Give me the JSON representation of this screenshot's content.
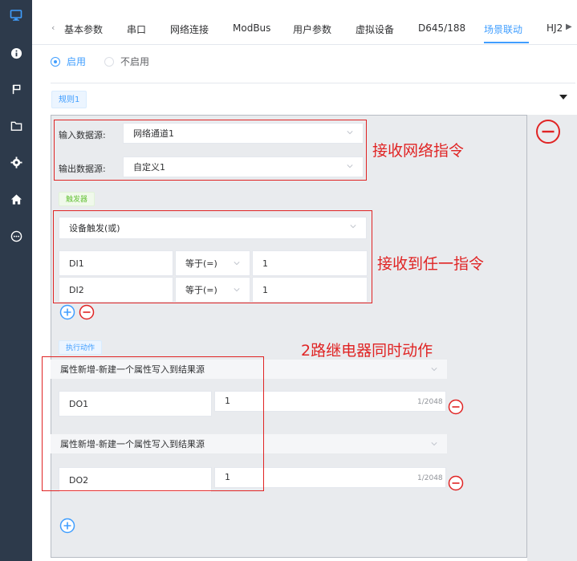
{
  "sidebar": {
    "icons": [
      "monitor-icon",
      "info-icon",
      "flag-icon",
      "folder-icon",
      "gear-icon",
      "home-icon",
      "chat-icon"
    ]
  },
  "tabs": {
    "items": [
      "基本参数",
      "串口",
      "网络连接",
      "ModBus",
      "用户参数",
      "虚拟设备",
      "D645/188",
      "场景联动",
      "HJ2"
    ],
    "active": "场景联动"
  },
  "enable": {
    "on_label": "启用",
    "off_label": "不启用"
  },
  "rule": {
    "tag": "规则1"
  },
  "source": {
    "input_label": "输入数据源:",
    "input_value": "网络通道1",
    "output_label": "输出数据源:",
    "output_value": "自定义1"
  },
  "trigger": {
    "tag": "触发器",
    "mode": "设备触发(或)",
    "rows": [
      {
        "name": "DI1",
        "op": "等于(=)",
        "value": "1"
      },
      {
        "name": "DI2",
        "op": "等于(=)",
        "value": "1"
      }
    ]
  },
  "action": {
    "tag": "执行动作",
    "items": [
      {
        "type": "属性新增-新建一个属性写入到结果源",
        "name": "DO1",
        "value": "1",
        "counter": "1/2048"
      },
      {
        "type": "属性新增-新建一个属性写入到结果源",
        "name": "DO2",
        "value": "1",
        "counter": "1/2048"
      }
    ]
  },
  "annotations": {
    "a1": "接收网络指令",
    "a2": "接收到任一指令",
    "a3": "2路继电器同时动作"
  },
  "colors": {
    "sidebar": "#2d3a4b",
    "accent": "#409eff",
    "danger": "#e02424",
    "panel": "#e9ebee"
  }
}
